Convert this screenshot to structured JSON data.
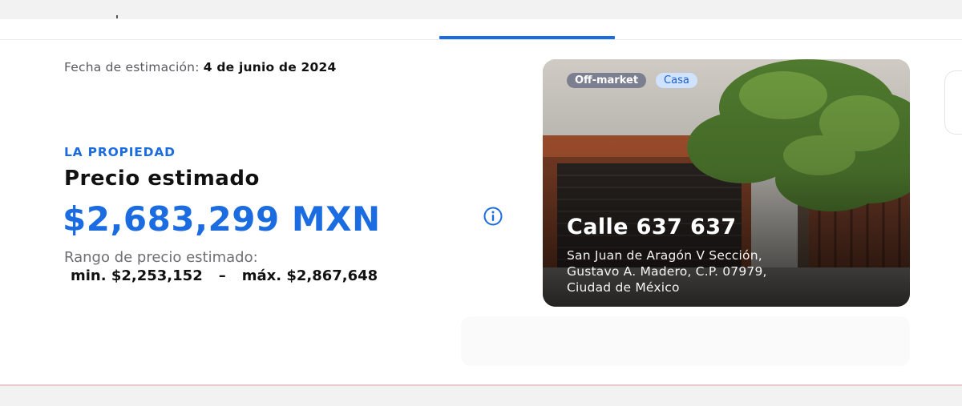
{
  "estimation": {
    "label": "Fecha de estimación:",
    "date": "4 de junio de 2024"
  },
  "property": {
    "eyebrow": "LA PROPIEDAD",
    "heading": "Precio estimado",
    "price": "$2,683,299 MXN",
    "info_icon": "info-circle-icon",
    "range_label": "Rango de precio estimado:",
    "range_min": "min. $2,253,152",
    "range_separator": "–",
    "range_max": "máx. $2,867,648"
  },
  "card": {
    "badges": [
      "Off-market",
      "Casa"
    ],
    "title": "Calle 637 637",
    "address_lines": [
      "San Juan de Aragón V Sección,",
      "Gustavo A. Madero, C.P. 07979,",
      "Ciudad de México"
    ]
  },
  "colors": {
    "accent": "#1b6ce0",
    "badge_off_market": "#7b7f8f",
    "badge_type_bg": "#cfe2ff",
    "heading_text": "#111111"
  }
}
